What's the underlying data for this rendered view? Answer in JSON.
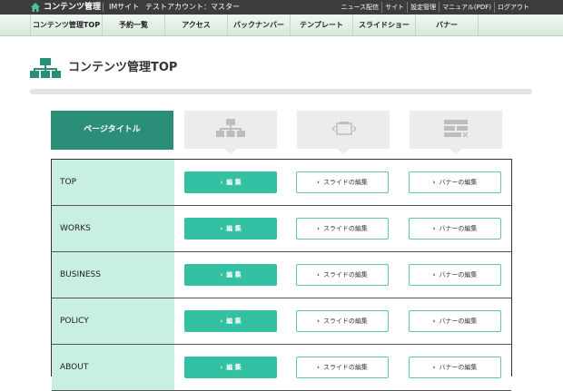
{
  "topbar": {
    "brand": "コンテンツ管理",
    "site": "IMサイト",
    "account": "テストアカウント：マスター",
    "links": [
      "ニュース配信",
      "サイト",
      "設定管理",
      "マニュアル(PDF)",
      "ログアウト"
    ]
  },
  "nav": [
    "コンテンツ管理TOP",
    "予約一覧",
    "アクセス",
    "バックナンバー",
    "テンプレート",
    "スライドショー",
    "バナー"
  ],
  "page": {
    "title": "コンテンツ管理TOP"
  },
  "columns": {
    "page_title": "ページタイトル"
  },
  "chevron": "›",
  "rows": [
    {
      "label": "TOP",
      "edit": "編 集",
      "slide": "スライドの編集",
      "banner": "バナーの編集"
    },
    {
      "label": "WORKS",
      "edit": "編 集",
      "slide": "スライドの編集",
      "banner": "バナーの編集"
    },
    {
      "label": "BUSINESS",
      "edit": "編 集",
      "slide": "スライドの編集",
      "banner": "バナーの編集"
    },
    {
      "label": "POLICY",
      "edit": "編 集",
      "slide": "スライドの編集",
      "banner": "バナーの編集"
    },
    {
      "label": "ABOUT",
      "edit": "編 集",
      "slide": "スライドの編集",
      "banner": "バナーの編集"
    }
  ],
  "colors": {
    "accent": "#2a8e78",
    "button": "#34c0a2",
    "row_label_bg": "#c9eee3"
  }
}
